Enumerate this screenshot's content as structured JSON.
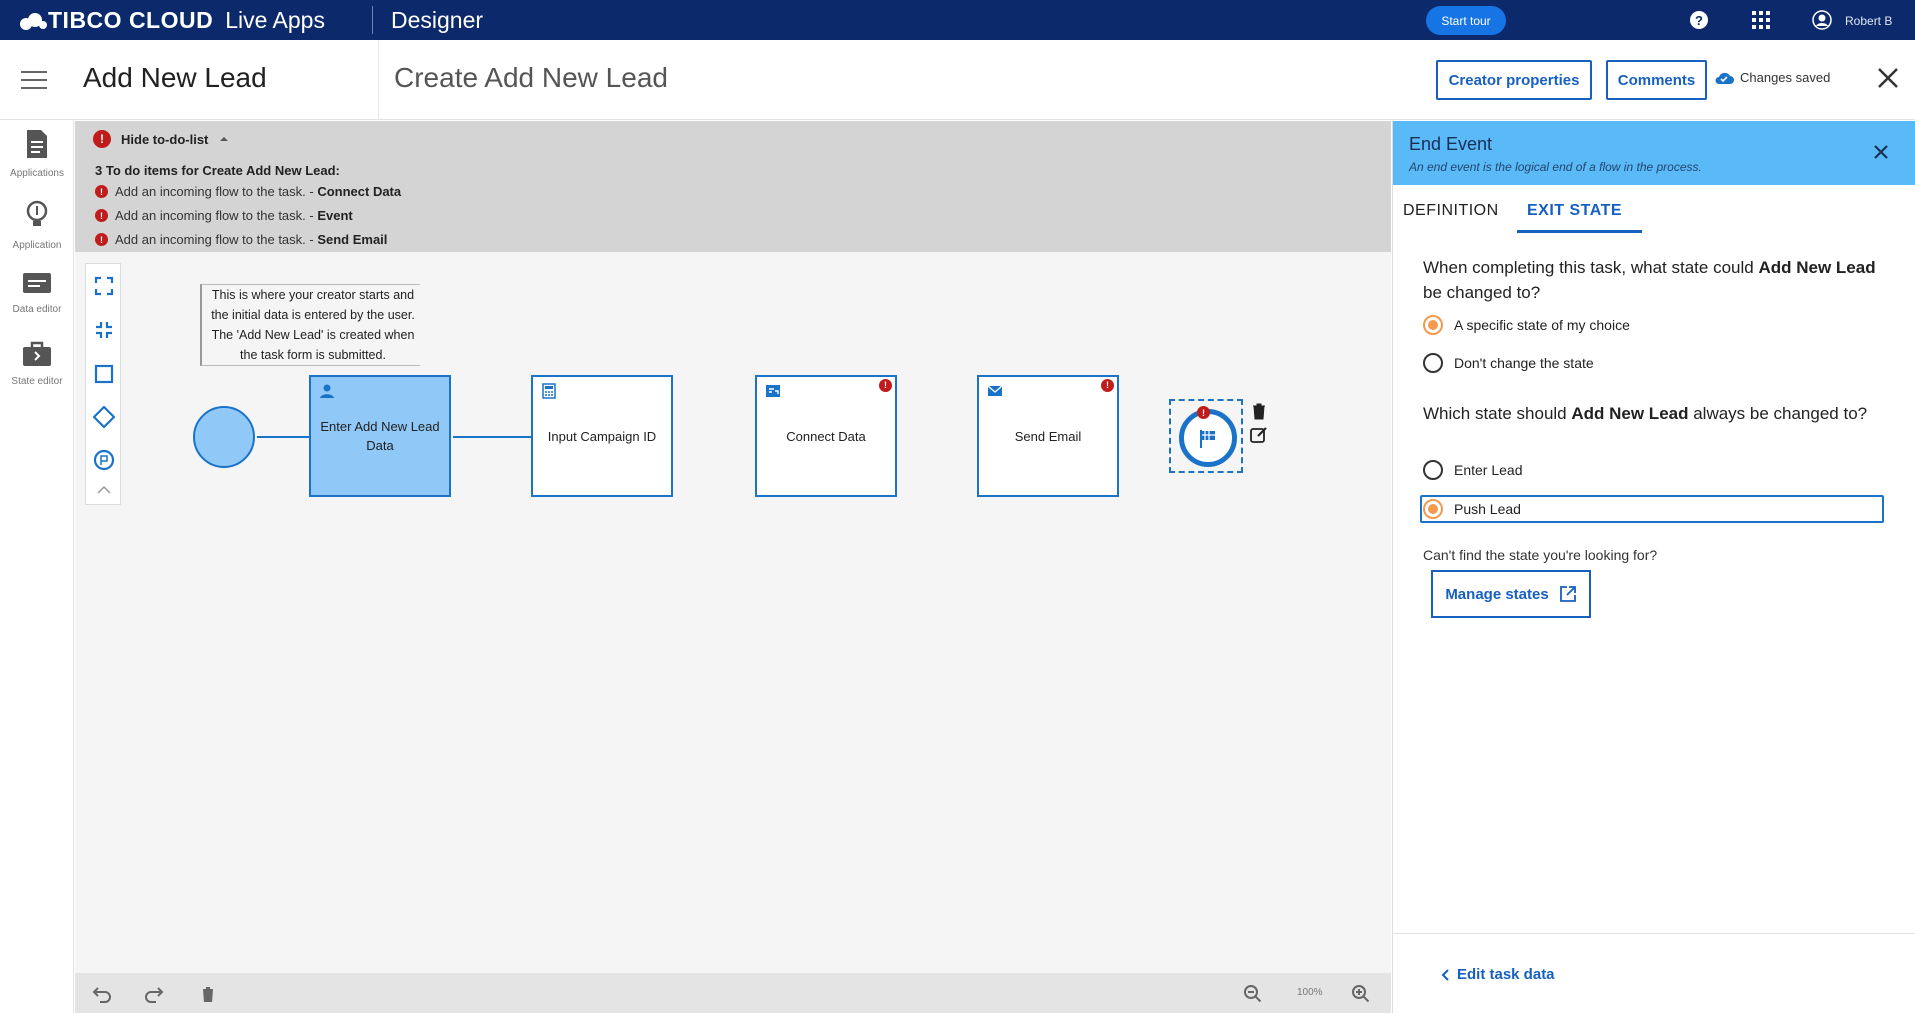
{
  "topbar": {
    "brand": "TIBCO CLOUD",
    "product": "Live Apps",
    "section": "Designer",
    "start_tour": "Start tour",
    "user": "Robert B"
  },
  "titlebar": {
    "app_title": "Add New Lead",
    "process_title": "Create Add New Lead",
    "creator_properties": "Creator properties",
    "comments": "Comments",
    "status": "Changes saved"
  },
  "rail": {
    "items": [
      {
        "label": "Applications",
        "icon": "document-icon"
      },
      {
        "label": "Application",
        "icon": "lightbulb-icon"
      },
      {
        "label": "Data editor",
        "icon": "data-editor-icon"
      },
      {
        "label": "State editor",
        "icon": "briefcase-icon"
      }
    ]
  },
  "todo": {
    "toggle": "Hide to-do-list",
    "summary": "3 To do items for Create Add New Lead:",
    "items": [
      {
        "text": "Add an incoming flow to the task. - ",
        "target": "Connect Data"
      },
      {
        "text": "Add an incoming flow to the task. - ",
        "target": "Event"
      },
      {
        "text": "Add an incoming flow to the task. - ",
        "target": "Send Email"
      }
    ]
  },
  "diagram": {
    "annotation": "This is where your creator starts and the initial data is entered by the user. The 'Add New Lead' is created when the task form is submitted.",
    "tasks": [
      {
        "label": "Enter Add New Lead Data",
        "icon": "user-icon",
        "error": false
      },
      {
        "label": "Input Campaign ID",
        "icon": "calculator-icon",
        "error": false
      },
      {
        "label": "Connect Data",
        "icon": "connector-icon",
        "error": true
      },
      {
        "label": "Send Email",
        "icon": "mail-icon",
        "error": true
      }
    ]
  },
  "canvas_footer": {
    "zoom": "100%"
  },
  "panel": {
    "title": "End Event",
    "subtitle": "An end event is the logical end of a flow in the process.",
    "tabs": [
      "DEFINITION",
      "EXIT STATE"
    ],
    "active_tab": "EXIT STATE",
    "q1_pre": "When completing this task, what state could ",
    "q1_bold": "Add New Lead",
    "q1_post": " be changed to?",
    "q1_options": [
      "A specific state of my choice",
      "Don't change the state"
    ],
    "q1_selected": "A specific state of my choice",
    "q2_pre": "Which state should ",
    "q2_bold": "Add New Lead",
    "q2_post": " always be changed to?",
    "q2_options": [
      "Enter Lead",
      "Push Lead"
    ],
    "q2_selected": "Push Lead",
    "help": "Can't find the state you're looking for?",
    "manage_states": "Manage states",
    "edit_task": "Edit task data"
  },
  "colors": {
    "topbar": "#0c2a6b",
    "accent": "#1760c0",
    "panel_header": "#5ab9f7",
    "selected_radio": "#f49a4a",
    "error": "#c01c1c"
  }
}
